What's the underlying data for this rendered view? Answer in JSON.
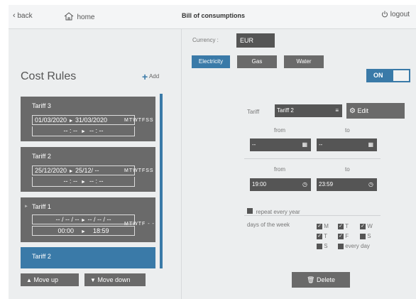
{
  "topbar": {
    "back_label": "back",
    "home_label": "home",
    "title": "Bill of consumptions",
    "logout_label": "logout"
  },
  "currency": {
    "label": "Currency :",
    "value": "EUR"
  },
  "tabs": [
    {
      "label": "Electricity",
      "active": true
    },
    {
      "label": "Gas",
      "active": false
    },
    {
      "label": "Water",
      "active": false
    }
  ],
  "toggle": {
    "label": "ON",
    "on": true
  },
  "cost_rules": {
    "heading": "Cost Rules",
    "add_label": "Add",
    "cards": [
      {
        "title": "Tariff 3",
        "date_from": "01/03/2020",
        "date_to": "31/03/2020",
        "time_from": "-- : --",
        "time_to": "-- : --",
        "days": "MTWTFSS"
      },
      {
        "title": "Tariff 2",
        "date_from": "25/12/2020",
        "date_to": "25/12/ --",
        "time_from": "-- : --",
        "time_to": "-- : --",
        "days": "MTWTFSS"
      },
      {
        "title": "Tariff 1",
        "date_from": "-- / -- / --",
        "date_to": "-- / -- / --",
        "time_from": "00:00",
        "time_to": "18:59",
        "days": "MTWTF - -"
      },
      {
        "title": "Tariff 2",
        "date_from": "-- / -- / --",
        "date_to": "-- / -- / --",
        "time_from": "",
        "time_to": "",
        "days": ""
      }
    ],
    "move_up_label": "Move up",
    "move_down_label": "Move down"
  },
  "editor": {
    "tariff_label": "Tariff",
    "tariff_value": "Tariff 2",
    "edit_label": "Edit",
    "from_label": "from",
    "to_label": "to",
    "date_from": "--",
    "date_to": "--",
    "time_from": "19:00",
    "time_to": "23:59",
    "repeat_label": "repeat every year",
    "days_label": "days of the week",
    "days": [
      {
        "label": "M",
        "checked": true
      },
      {
        "label": "T",
        "checked": true
      },
      {
        "label": "W",
        "checked": true
      },
      {
        "label": "T",
        "checked": true
      },
      {
        "label": "F",
        "checked": true
      },
      {
        "label": "S",
        "checked": false
      },
      {
        "label": "S",
        "checked": false
      },
      {
        "label": "every day",
        "checked": false
      }
    ],
    "delete_label": "Delete"
  },
  "colors": {
    "accent": "#3a7aa8",
    "card": "#6a6a6a",
    "field": "#555555"
  }
}
